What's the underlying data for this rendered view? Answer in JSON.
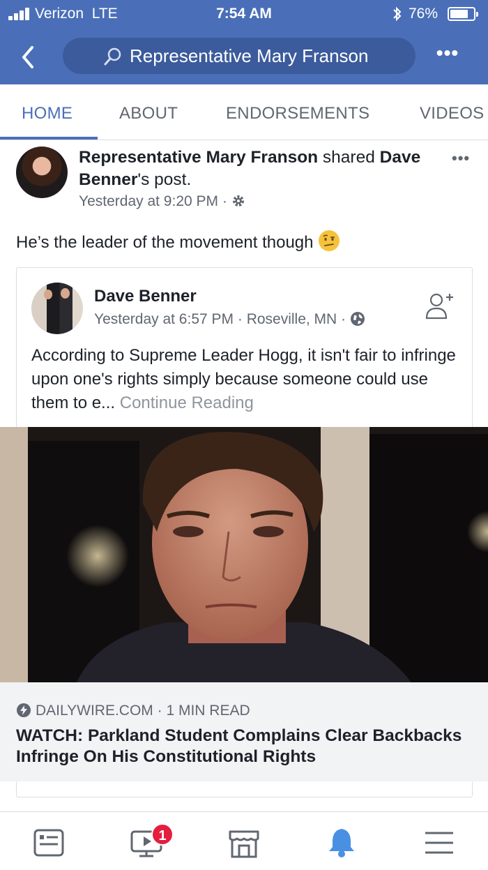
{
  "status_bar": {
    "carrier": "Verizon",
    "network": "LTE",
    "time": "7:54 AM",
    "bluetooth_icon": "bluetooth-icon",
    "battery": "76%"
  },
  "search": {
    "value": "Representative Mary Franson",
    "back_icon": "back-arrow-icon",
    "more_icon": "more-icon"
  },
  "tabs": [
    {
      "label": "HOME",
      "active": true
    },
    {
      "label": "ABOUT",
      "active": false
    },
    {
      "label": "ENDORSEMENTS",
      "active": false
    },
    {
      "label": "VIDEOS",
      "active": false
    }
  ],
  "post": {
    "author": "Representative Mary Franson",
    "shared_word": " shared",
    "shared_from": "Dave Benner",
    "shared_suffix": "'s post.",
    "timestamp": "Yesterday at 9:20 PM",
    "meta_separator": " · ",
    "text": "He’s the leader of the movement though",
    "emoji": "raised-eyebrow-emoji"
  },
  "shared_post": {
    "author": "Dave Benner",
    "timestamp": "Yesterday at 6:57 PM",
    "location": "Roseville, MN",
    "text": "According to Supreme Leader Hogg, it isn't fair to infringe upon one's rights simply because someone could use them to e...",
    "continue_label": "Continue Reading"
  },
  "link_preview": {
    "source": "DAILYWIRE.COM",
    "read_time": "1 MIN READ",
    "separator": " · ",
    "headline": "WATCH: Parkland Student Complains Clear Backbacks Infringe On His Constitutional Rights"
  },
  "bottom_nav": {
    "items": [
      "news-feed-icon",
      "video-icon",
      "marketplace-icon",
      "notifications-icon",
      "menu-icon"
    ],
    "video_badge": "1",
    "active_color": "#4a90e2"
  },
  "colors": {
    "brand": "#4a6fb8",
    "search_bg": "#3b5b9c",
    "text_secondary": "#606770",
    "badge": "#e41e3f"
  }
}
